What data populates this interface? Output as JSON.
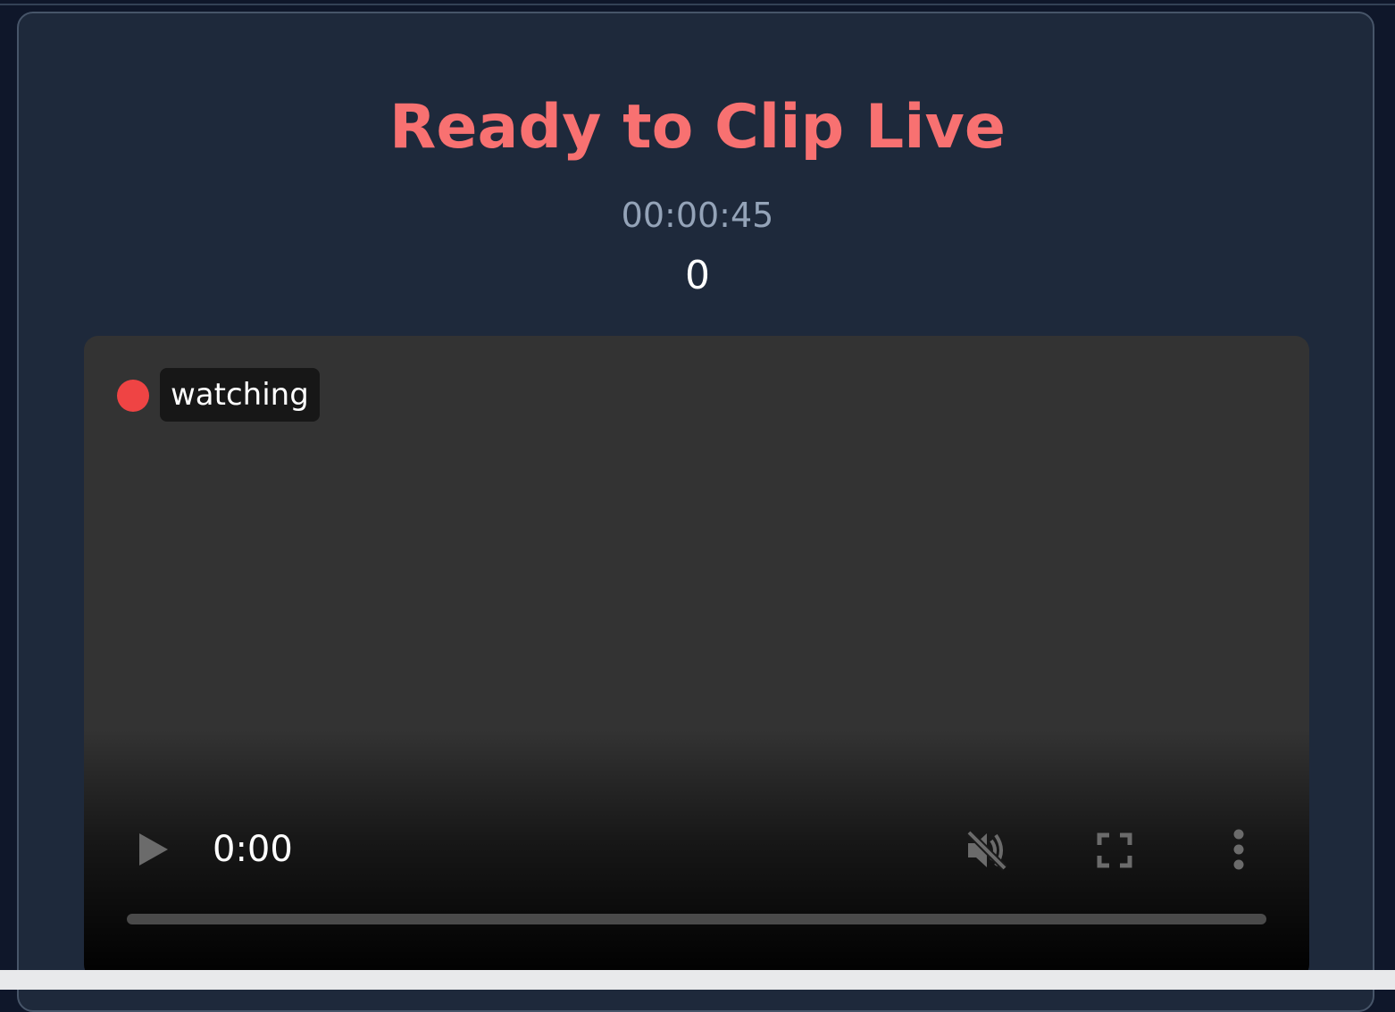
{
  "header": {
    "title": "Ready to Clip Live",
    "timer": "00:00:45",
    "count": "0"
  },
  "player": {
    "status_label": "watching",
    "current_time": "0:00",
    "progress_fraction": 0,
    "muted": true,
    "icons": [
      "live-dot",
      "play-icon",
      "muted-volume-icon",
      "fullscreen-icon",
      "more-options-icon"
    ]
  },
  "colors": {
    "title": "#f87171",
    "live_dot": "#ef4444",
    "card_background": "#1e293b",
    "page_background": "#0f172a"
  }
}
